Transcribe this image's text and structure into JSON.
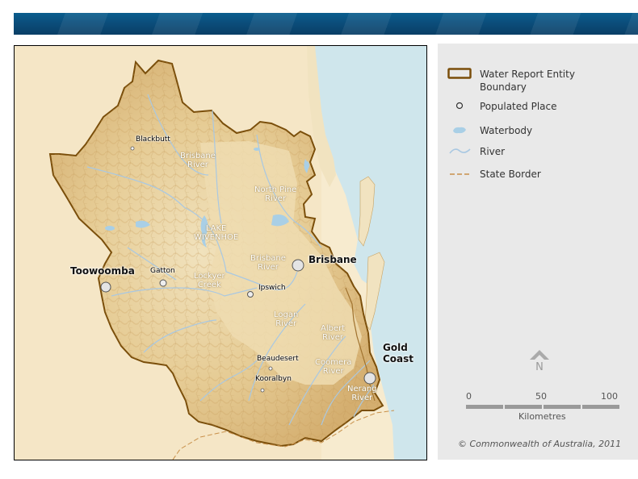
{
  "colors": {
    "boundary": "#7a4e0a",
    "sea": "#cfe6ec",
    "terrain_light": "#f0dfb7",
    "terrain_dark": "#cba064",
    "river": "#a9c8e2",
    "waterbody": "#a9cfe6",
    "legend_bg": "#e9e9e9",
    "banner": "#0b4f7d"
  },
  "map": {
    "river_labels": [
      {
        "id": "brisbane-river-upper",
        "text": "Brisbane\nRiver"
      },
      {
        "id": "north-pine-river",
        "text": "North Pine\nRiver"
      },
      {
        "id": "lake-wivenhoe",
        "text": "LAKE\nWIVENHOE"
      },
      {
        "id": "brisbane-river-lower",
        "text": "Brisbane\nRiver"
      },
      {
        "id": "lockyer-creek",
        "text": "Lockyer\nCreek"
      },
      {
        "id": "logan-river",
        "text": "Logan\nRiver"
      },
      {
        "id": "albert-river",
        "text": "Albert\nRiver"
      },
      {
        "id": "coomera-river",
        "text": "Coomera\nRiver"
      },
      {
        "id": "nerang-river",
        "text": "Nerang\nRiver"
      }
    ],
    "towns": [
      {
        "id": "blackbutt",
        "name": "Blackbutt"
      },
      {
        "id": "gatton",
        "name": "Gatton"
      },
      {
        "id": "ipswich",
        "name": "Ipswich"
      },
      {
        "id": "beaudesert",
        "name": "Beaudesert"
      },
      {
        "id": "kooralbyn",
        "name": "Kooralbyn"
      }
    ],
    "cities": [
      {
        "id": "toowoomba",
        "name": "Toowoomba"
      },
      {
        "id": "brisbane",
        "name": "Brisbane"
      },
      {
        "id": "gold-coast",
        "name": "Gold\nCoast"
      }
    ]
  },
  "legend": {
    "items": [
      {
        "id": "boundary",
        "label": "Water Report Entity\nBoundary",
        "icon": "boundary-rectangle-icon"
      },
      {
        "id": "populated-place",
        "label": "Populated Place",
        "icon": "populated-place-icon"
      },
      {
        "id": "waterbody",
        "label": "Waterbody",
        "icon": "waterbody-icon"
      },
      {
        "id": "river",
        "label": "River",
        "icon": "river-icon"
      },
      {
        "id": "state-border",
        "label": "State Border",
        "icon": "state-border-icon"
      }
    ],
    "north_letter": "N",
    "scale": {
      "ticks": [
        "0",
        "50",
        "100"
      ],
      "unit": "Kilometres"
    },
    "copyright": "© Commonwealth of Australia, 2011"
  }
}
